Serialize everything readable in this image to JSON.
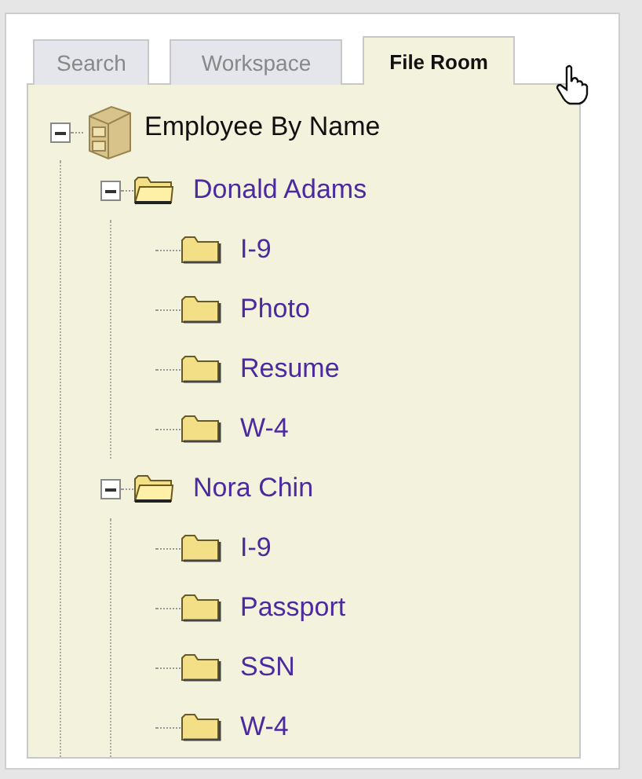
{
  "tabs": [
    {
      "label": "Search",
      "selected": false
    },
    {
      "label": "Workspace",
      "selected": false
    },
    {
      "label": "File Room",
      "selected": true
    }
  ],
  "tree": [
    {
      "label": "Employee By Name",
      "kind": "cabinet",
      "expanded": true,
      "children": [
        {
          "label": "Donald Adams",
          "kind": "folder",
          "expanded": true,
          "children": [
            {
              "label": "I-9",
              "kind": "folder"
            },
            {
              "label": "Photo",
              "kind": "folder"
            },
            {
              "label": "Resume",
              "kind": "folder"
            },
            {
              "label": "W-4",
              "kind": "folder"
            }
          ]
        },
        {
          "label": "Nora Chin",
          "kind": "folder",
          "expanded": true,
          "children": [
            {
              "label": "I-9",
              "kind": "folder"
            },
            {
              "label": "Passport",
              "kind": "folder"
            },
            {
              "label": "SSN",
              "kind": "folder"
            },
            {
              "label": "W-4",
              "kind": "folder"
            }
          ]
        }
      ]
    }
  ]
}
